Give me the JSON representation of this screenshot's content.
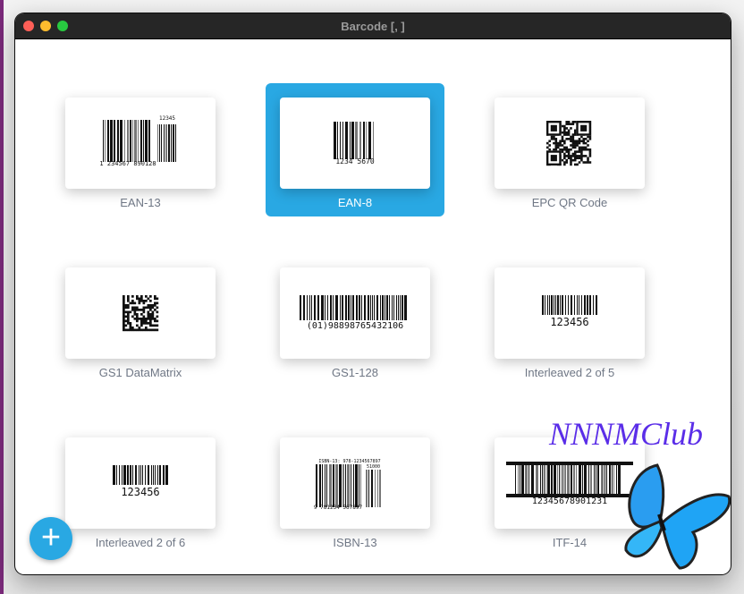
{
  "window": {
    "title": "Barcode [, ]"
  },
  "items": [
    {
      "label": "EAN-13",
      "type": "ean13",
      "text": "1 234567 890128",
      "addon": "12345",
      "selected": false
    },
    {
      "label": "EAN-8",
      "type": "ean8",
      "text": "1234 5670",
      "selected": true
    },
    {
      "label": "EPC QR Code",
      "type": "qr",
      "selected": false
    },
    {
      "label": "GS1 DataMatrix",
      "type": "matrix",
      "selected": false
    },
    {
      "label": "GS1-128",
      "type": "gs1",
      "text": "(01)98898765432106",
      "selected": false
    },
    {
      "label": "Interleaved 2 of 5",
      "type": "i25",
      "text": "123456",
      "selected": false
    },
    {
      "label": "Interleaved 2 of 6",
      "type": "i25",
      "text": "123456",
      "selected": false
    },
    {
      "label": "ISBN-13",
      "type": "isbn",
      "text": "9 781234 567897",
      "toptext": "ISBN-13: 978-1234567897",
      "addon": "51000",
      "selected": false
    },
    {
      "label": "ITF-14",
      "type": "itf",
      "text": "12345678901231",
      "selected": false
    }
  ],
  "add_button": {
    "label": "+"
  },
  "watermark": {
    "text": "NNNMClub"
  }
}
